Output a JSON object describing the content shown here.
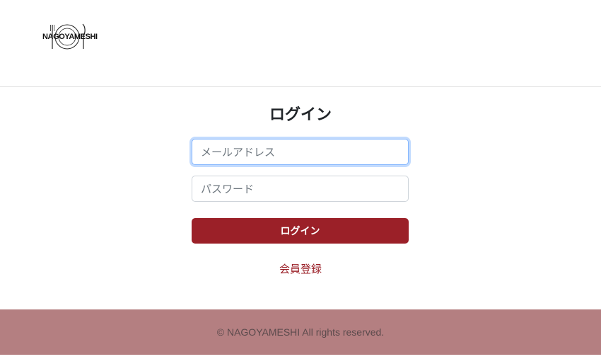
{
  "header": {
    "logo_text": "NAGOYAMESHI"
  },
  "login": {
    "title": "ログイン",
    "email_placeholder": "メールアドレス",
    "password_placeholder": "パスワード",
    "submit_label": "ログイン",
    "register_link": "会員登録"
  },
  "footer": {
    "copyright": "© NAGOYAMESHI All rights reserved."
  },
  "colors": {
    "brand": "#9b2028",
    "footer_bg": "#b47f81",
    "focus_ring": "#86b7fe"
  }
}
